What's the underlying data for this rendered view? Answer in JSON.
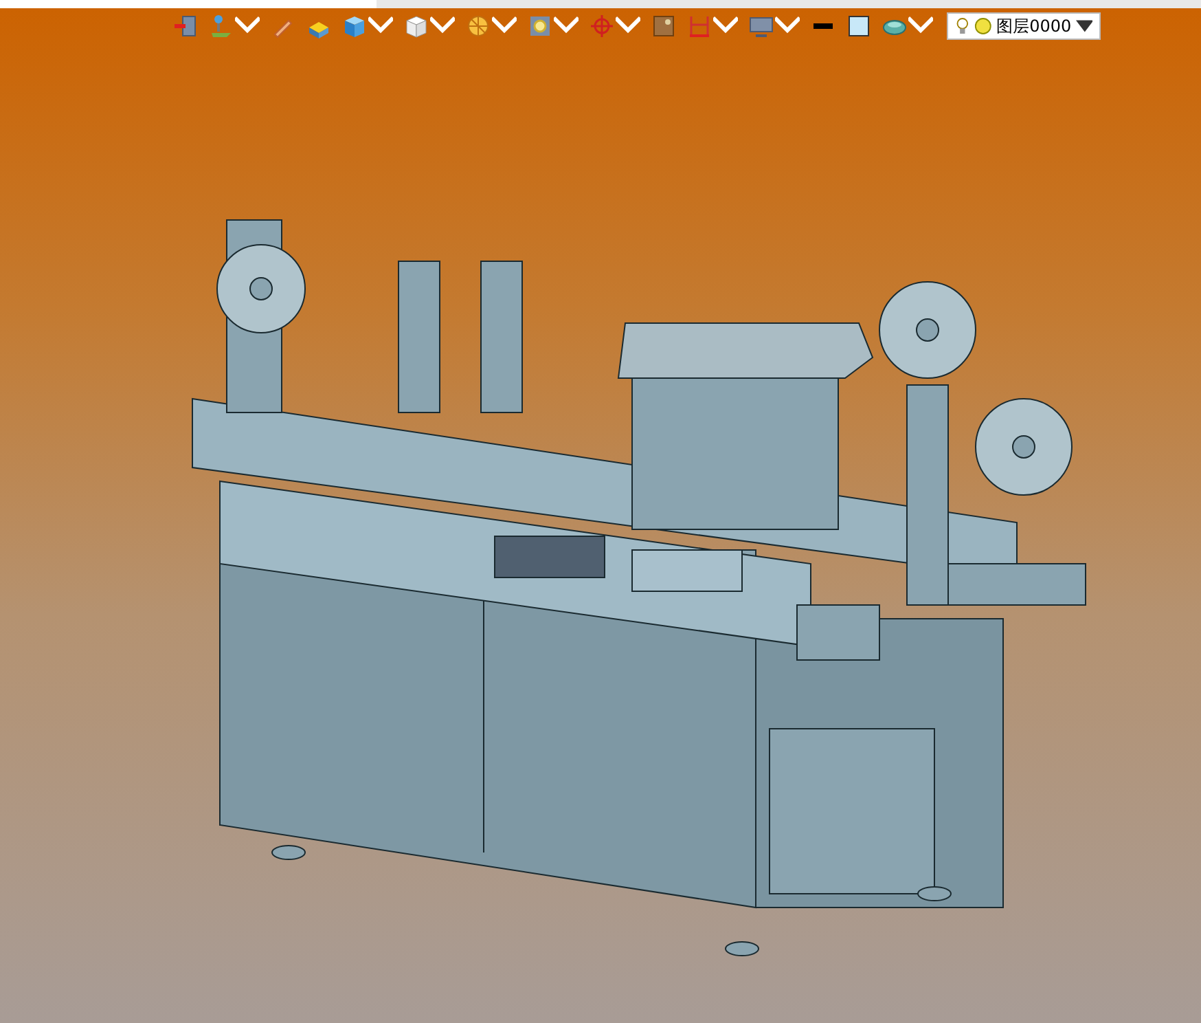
{
  "toolbar": {
    "items": [
      {
        "kind": "exit",
        "has_menu": false
      },
      {
        "kind": "pin",
        "has_menu": true
      },
      {
        "kind": "pencil",
        "has_menu": false
      },
      {
        "kind": "slab",
        "has_menu": false
      },
      {
        "kind": "solid-cube",
        "has_menu": true
      },
      {
        "kind": "outline-cube",
        "has_menu": true
      },
      {
        "kind": "section",
        "has_menu": true
      },
      {
        "kind": "zoom",
        "has_menu": true
      },
      {
        "kind": "crosshair",
        "has_menu": true
      },
      {
        "kind": "frame",
        "has_menu": false
      },
      {
        "kind": "ruler",
        "has_menu": true
      },
      {
        "kind": "monitor",
        "has_menu": true
      },
      {
        "kind": "line",
        "has_menu": false
      },
      {
        "kind": "fill",
        "has_menu": false
      },
      {
        "kind": "cloud",
        "has_menu": true
      }
    ]
  },
  "layer_selector": {
    "value": "图层0000",
    "visible": true
  }
}
